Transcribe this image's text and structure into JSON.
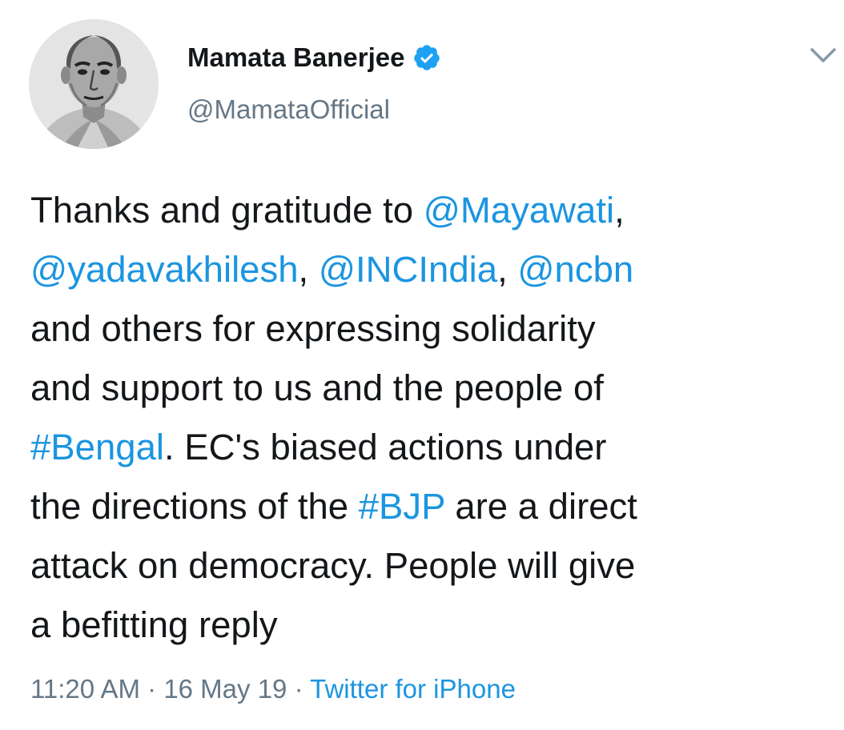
{
  "colors": {
    "text": "#14171a",
    "secondary": "#657786",
    "link": "#1b95e0",
    "verified": "#1da1f2"
  },
  "author": {
    "display_name": "Mamata Banerjee",
    "handle": "@MamataOfficial",
    "verified": true,
    "avatar_icon": "portrait-avatar"
  },
  "menu": {
    "icon": "chevron-down-icon"
  },
  "tweet": {
    "lines": [
      [
        {
          "text": "Thanks and gratitude to ",
          "type": "text"
        },
        {
          "text": "@Mayawati",
          "type": "mention"
        },
        {
          "text": ",",
          "type": "text"
        }
      ],
      [
        {
          "text": "@yadavakhilesh",
          "type": "mention"
        },
        {
          "text": ", ",
          "type": "text"
        },
        {
          "text": "@INCIndia",
          "type": "mention"
        },
        {
          "text": ", ",
          "type": "text"
        },
        {
          "text": "@ncbn",
          "type": "mention"
        }
      ],
      [
        {
          "text": "and others for expressing solidarity",
          "type": "text"
        }
      ],
      [
        {
          "text": "and support to us and the people of",
          "type": "text"
        }
      ],
      [
        {
          "text": "#Bengal",
          "type": "hashtag"
        },
        {
          "text": ". EC's biased actions under",
          "type": "text"
        }
      ],
      [
        {
          "text": "the directions of the ",
          "type": "text"
        },
        {
          "text": "#BJP",
          "type": "hashtag"
        },
        {
          "text": " are a direct",
          "type": "text"
        }
      ],
      [
        {
          "text": "attack on democracy. People will give",
          "type": "text"
        }
      ],
      [
        {
          "text": "a befitting reply",
          "type": "text"
        }
      ]
    ]
  },
  "meta": {
    "time": "11:20 AM",
    "separator": " · ",
    "date": "16 May 19",
    "source": "Twitter for iPhone"
  }
}
